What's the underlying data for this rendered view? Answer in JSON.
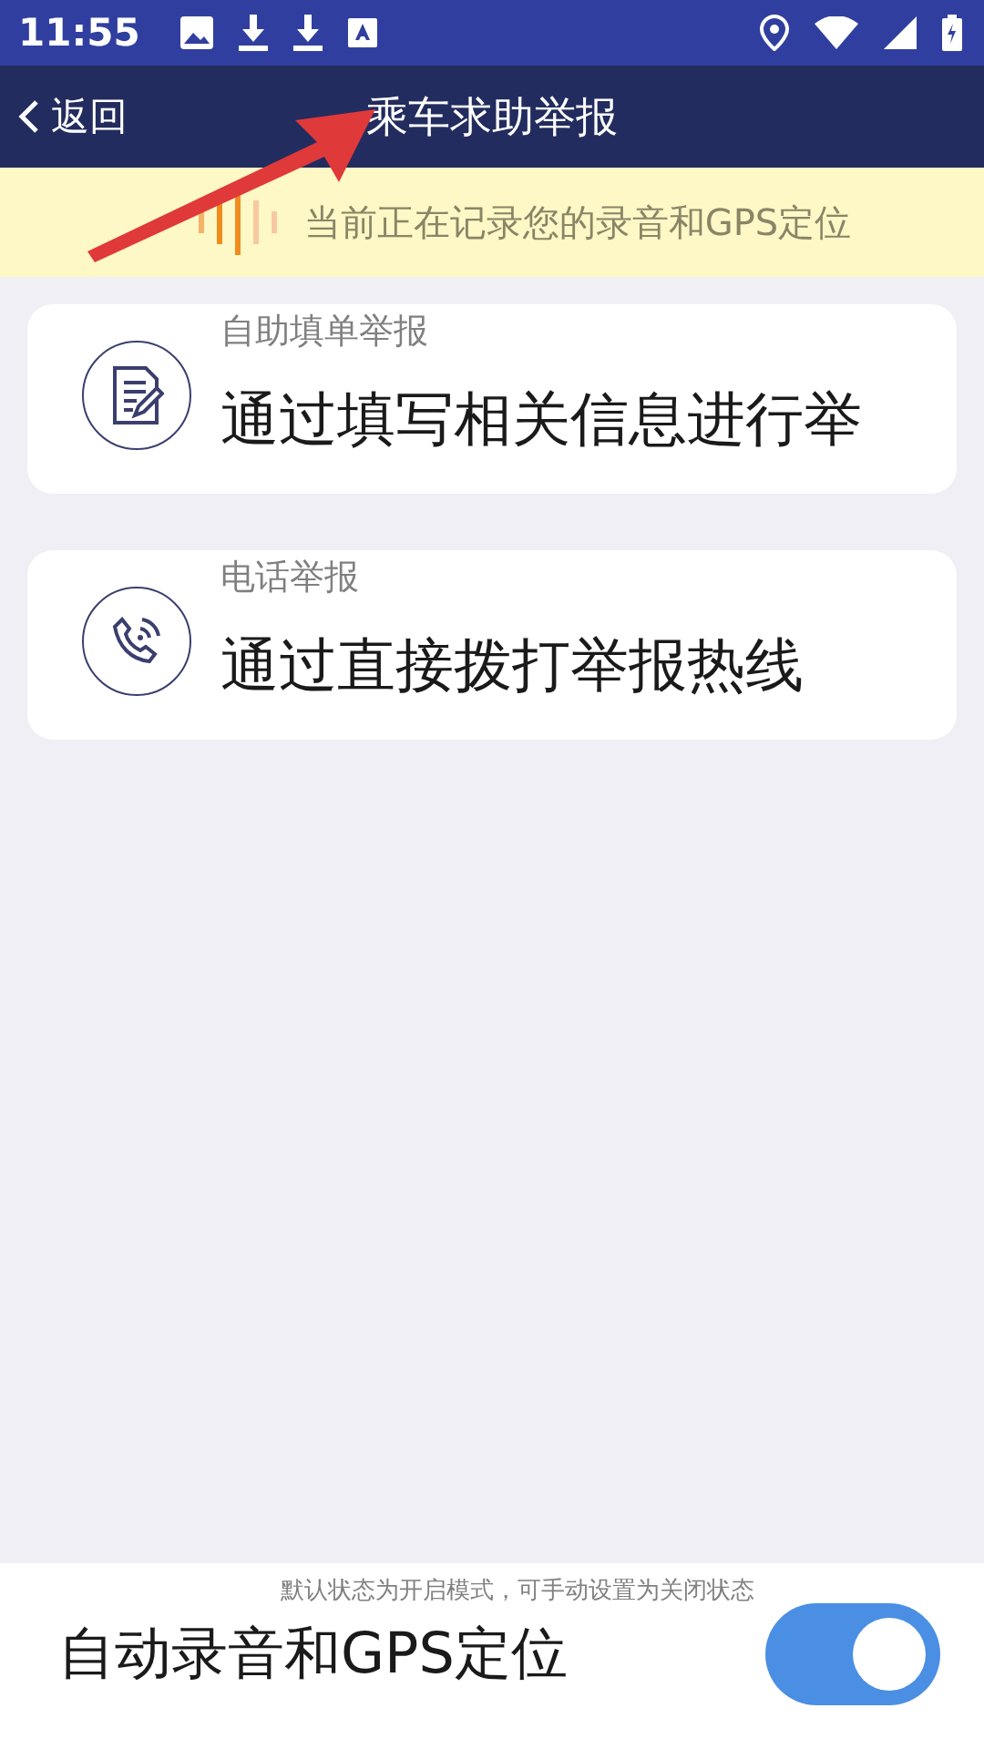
{
  "status_bar": {
    "time": "11:55"
  },
  "header": {
    "back_label": "返回",
    "title": "乘车求助举报"
  },
  "banner": {
    "text": "当前正在记录您的录音和GPS定位"
  },
  "options": [
    {
      "kind": "form",
      "label": "自助填单举报",
      "description": "通过填写相关信息进行举"
    },
    {
      "kind": "phone",
      "label": "电话举报",
      "description": "通过直接拨打举报热线"
    }
  ],
  "auto_record": {
    "hint": "默认状态为开启模式，可手动设置为关闭状态",
    "label": "自动录音和GPS定位",
    "on": true
  }
}
